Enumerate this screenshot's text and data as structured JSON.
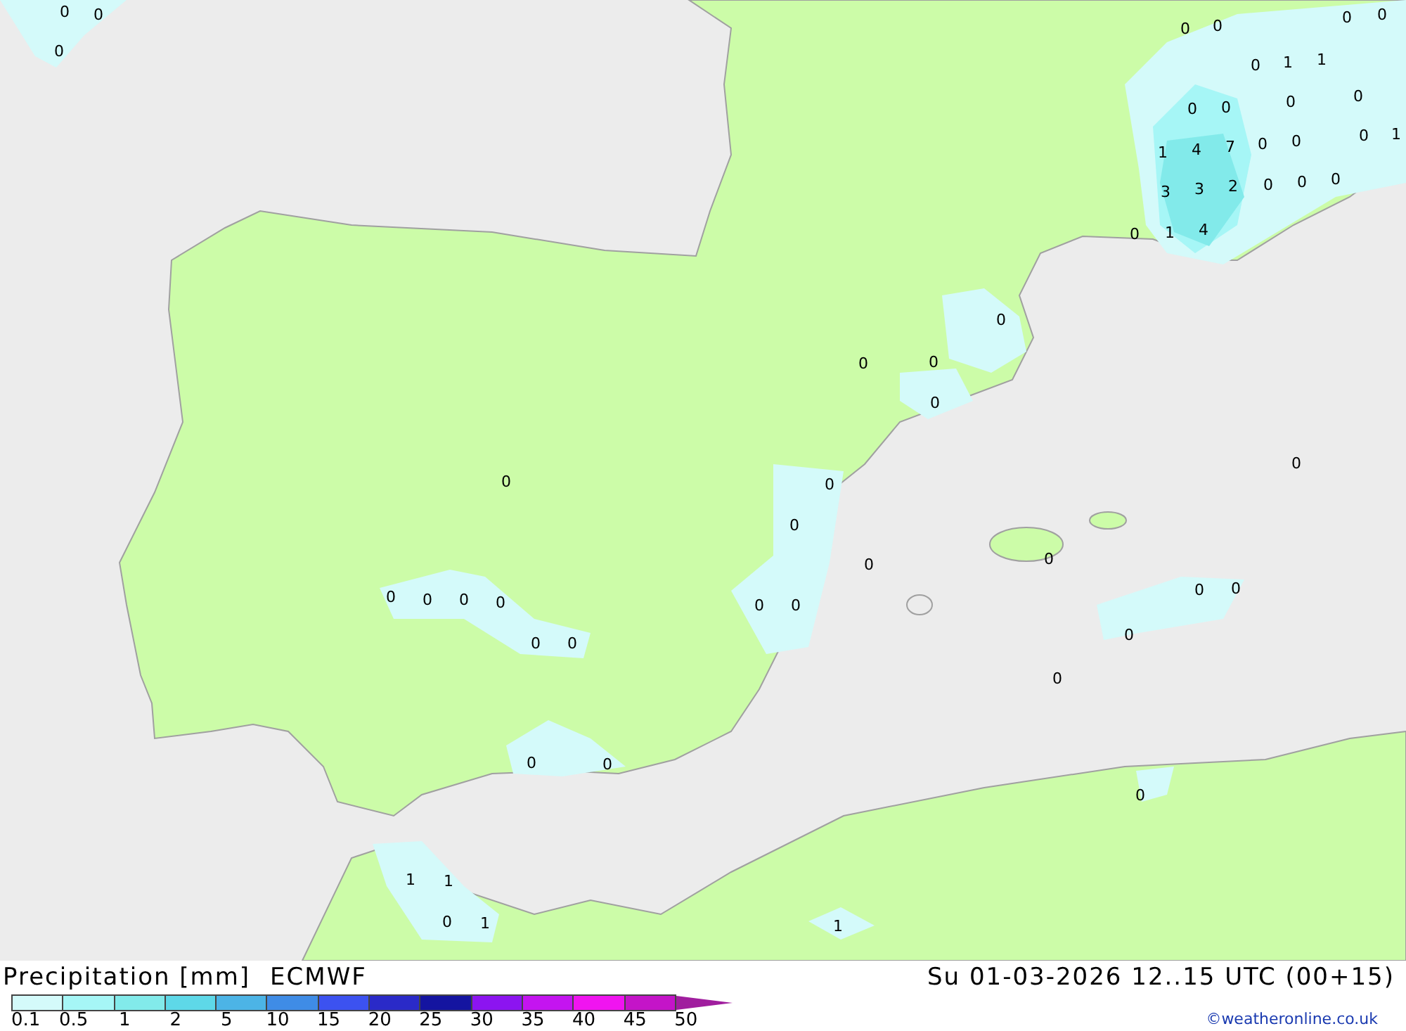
{
  "map_values": [
    "0",
    "0",
    "0",
    "0",
    "0",
    "0",
    "0",
    "0",
    "1",
    "1",
    "0",
    "0",
    "0",
    "0",
    "1",
    "4",
    "7",
    "0",
    "0",
    "0",
    "1",
    "3",
    "3",
    "2",
    "0",
    "0",
    "0",
    "0",
    "1",
    "4",
    "0",
    "0",
    "0",
    "0",
    "0",
    "0",
    "0",
    "0",
    "0",
    "0",
    "0",
    "0",
    "0",
    "0",
    "0",
    "0",
    "0",
    "0",
    "0",
    "0",
    "0",
    "0",
    "0",
    "0",
    "0",
    "1",
    "1",
    "0",
    "1",
    "1"
  ],
  "legend": {
    "title": "Precipitation [mm]",
    "model": "ECMWF",
    "items": [
      {
        "label": "0.1",
        "color": "#d4fafa"
      },
      {
        "label": "0.5",
        "color": "#a6f6f6"
      },
      {
        "label": "1",
        "color": "#82eaea"
      },
      {
        "label": "2",
        "color": "#5ed8e8"
      },
      {
        "label": "5",
        "color": "#4cb4e6"
      },
      {
        "label": "10",
        "color": "#3f8ce6"
      },
      {
        "label": "15",
        "color": "#3c52f0"
      },
      {
        "label": "20",
        "color": "#2a2ac8"
      },
      {
        "label": "25",
        "color": "#1414a0"
      },
      {
        "label": "30",
        "color": "#8c14f0"
      },
      {
        "label": "35",
        "color": "#c414f0"
      },
      {
        "label": "40",
        "color": "#f014f0"
      },
      {
        "label": "45",
        "color": "#c414c8"
      }
    ],
    "end_label": "50"
  },
  "datetime": "Su 01-03-2026 12..15 UTC (00+15)",
  "credit": "©weatheronline.co.uk"
}
